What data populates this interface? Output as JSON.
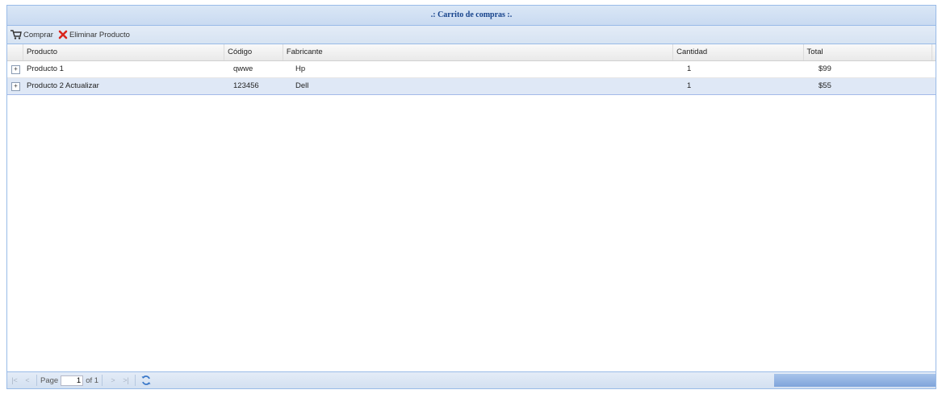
{
  "panel": {
    "title": ".: Carrito de compras :."
  },
  "toolbar": {
    "comprar_label": "Comprar",
    "eliminar_label": "Eliminar Producto"
  },
  "columns": [
    "Producto",
    "Código",
    "Fabricante",
    "Cantidad",
    "Total"
  ],
  "rows": [
    {
      "expander": "+",
      "producto": "Producto 1",
      "codigo": "qwwe",
      "fabricante": "Hp",
      "cantidad": "1",
      "total": "$99"
    },
    {
      "expander": "+",
      "producto": "Producto 2 Actualizar",
      "codigo": "123456",
      "fabricante": "Dell",
      "cantidad": "1",
      "total": "$55"
    }
  ],
  "pager": {
    "page_label": "Page",
    "page_value": "1",
    "of_label": "of 1"
  },
  "colors": {
    "header_text": "#15428b",
    "border": "#99bbe8",
    "selected_row": "#dfe8f6"
  }
}
